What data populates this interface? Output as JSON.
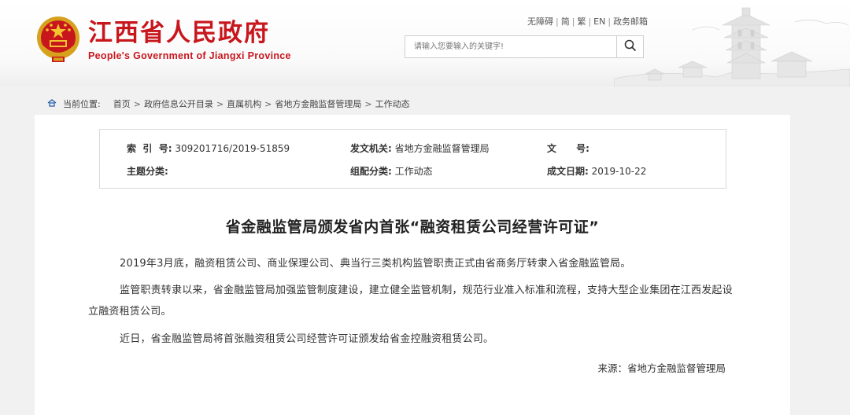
{
  "header": {
    "title_cn": "江西省人民政府",
    "title_en": "People's Government of Jiangxi Province",
    "brand_color": "#c8161d",
    "links": [
      "无障碍",
      "简",
      "繁",
      "EN",
      "政务邮箱"
    ],
    "search": {
      "placeholder": "请输入您要输入的关键字!",
      "button_icon": "search-icon"
    }
  },
  "breadcrumb": {
    "label": "当前位置:",
    "icon": "home-icon",
    "items": [
      "首页",
      "政府信息公开目录",
      "直属机构",
      "省地方金融监督管理局",
      "工作动态"
    ]
  },
  "meta": {
    "index_key": "索  引  号:",
    "index_value": "309201716/2019-51859",
    "issuer_key": "发文机关:",
    "issuer_value": "省地方金融监督管理局",
    "docno_key": "文      号:",
    "docno_value": "",
    "topic_key": "主题分类:",
    "topic_value": "",
    "group_key": "组配分类:",
    "group_value": "工作动态",
    "date_key": "成文日期:",
    "date_value": "2019-10-22"
  },
  "article": {
    "title": "省金融监管局颁发省内首张“融资租赁公司经营许可证”",
    "paragraphs": [
      "2019年3月底，融资租赁公司、商业保理公司、典当行三类机构监管职责正式由省商务厅转隶入省金融监管局。",
      "监管职责转隶以来，省金融监管局加强监管制度建设，建立健全监管机制，规范行业准入标准和流程，支持大型企业集团在江西发起设立融资租赁公司。",
      "近日，省金融监管局将首张融资租赁公司经营许可证颁发给省金控融资租赁公司。"
    ],
    "source": "来源：省地方金融监督管理局"
  }
}
